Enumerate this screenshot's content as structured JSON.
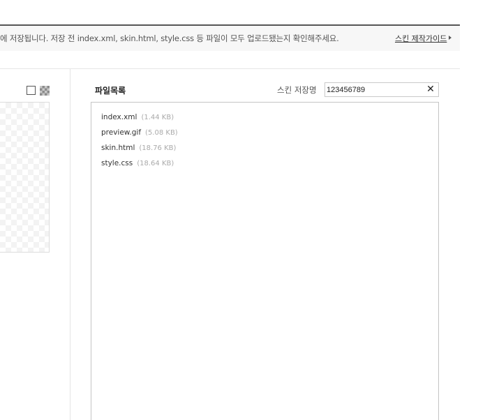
{
  "info_bar": {
    "message": "에 저장됩니다. 저장 전 index.xml, skin.html, style.css 등 파일이 모두 업로드됐는지 확인해주세요.",
    "guide_link": "스킨 제작가이드"
  },
  "preview": {
    "background_options": [
      "white",
      "checker"
    ]
  },
  "file_panel": {
    "title": "파일목록",
    "skin_name_label": "스킨 저장명",
    "skin_name_value": "123456789",
    "clear_symbol": "✕",
    "files": [
      {
        "name": "index.xml",
        "size": "(1.44 KB)"
      },
      {
        "name": "preview.gif",
        "size": "(5.08 KB)"
      },
      {
        "name": "skin.html",
        "size": "(18.76 KB)"
      },
      {
        "name": "style.css",
        "size": "(18.64 KB)"
      }
    ]
  }
}
